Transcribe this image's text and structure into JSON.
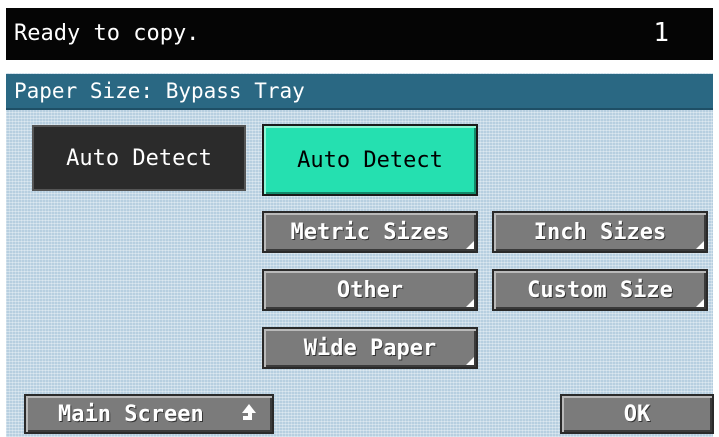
{
  "status": {
    "message": "Ready to copy.",
    "count": "1"
  },
  "dialog": {
    "title": "Paper Size: Bypass Tray",
    "current_setting": "Auto Detect"
  },
  "options": {
    "auto_detect": "Auto Detect",
    "metric_sizes": "Metric Sizes",
    "inch_sizes": "Inch Sizes",
    "other": "Other",
    "custom_size": "Custom Size",
    "wide_paper": "Wide Paper"
  },
  "footer": {
    "main_screen": "Main Screen",
    "ok": "OK"
  },
  "colors": {
    "selected": "#25e0b0",
    "title_bar": "#2a6883",
    "panel": "#b7cfe0"
  }
}
